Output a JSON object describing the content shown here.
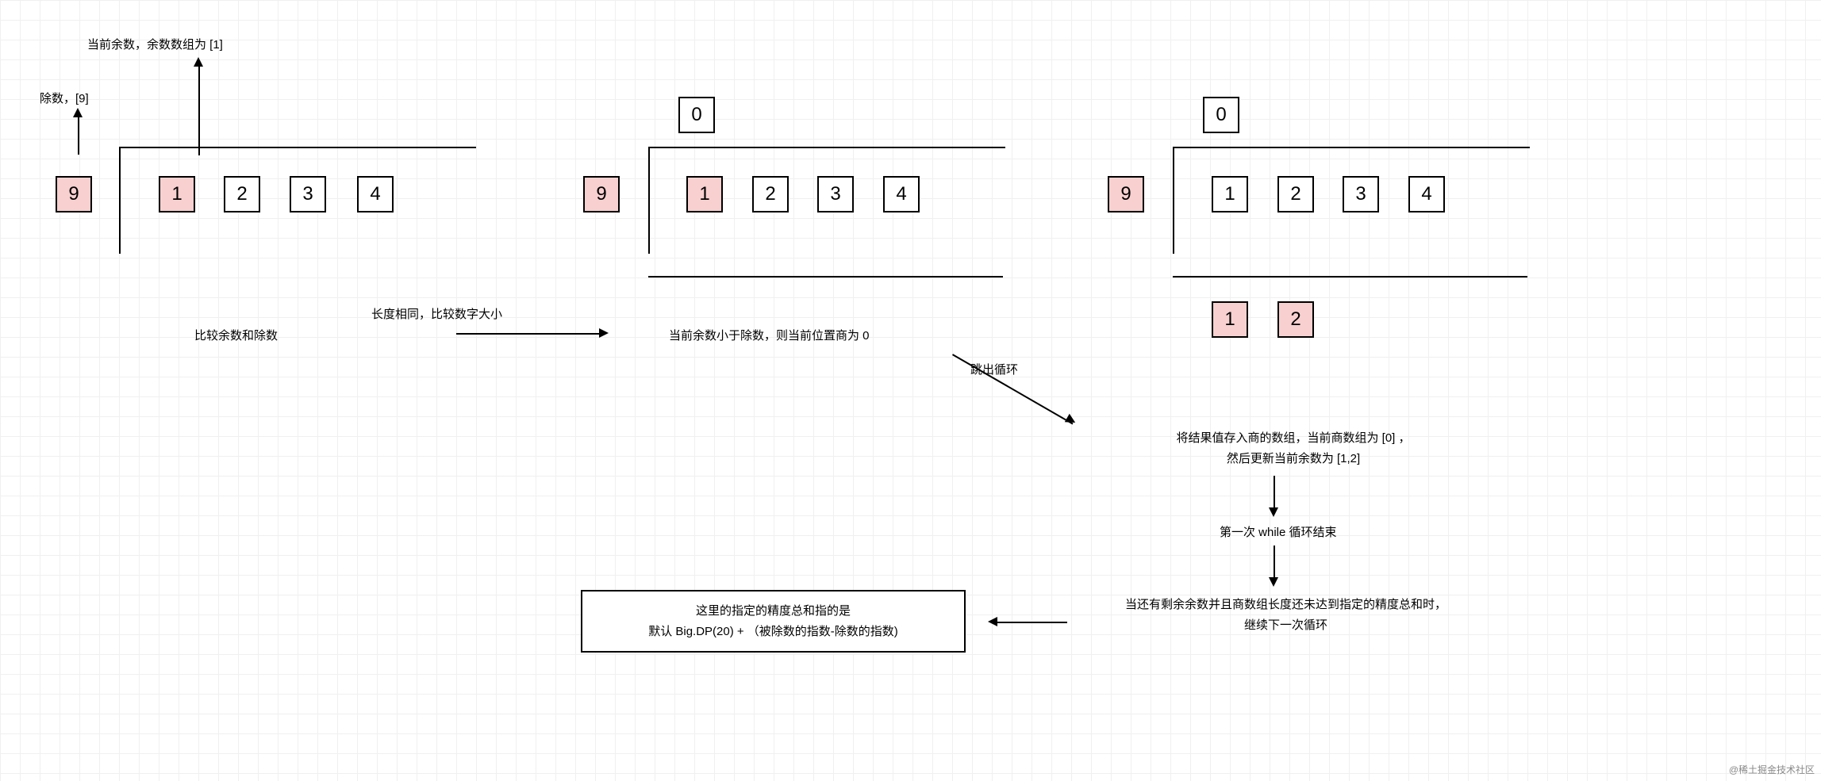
{
  "labels": {
    "divisor_label": "除数，[9]",
    "remainder_label": "当前余数，余数数组为 [1]",
    "step1_compare": "比较余数和除数",
    "step1_arrow_text": "长度相同，比较数字大小",
    "step2_text": "当前余数小于除数，则当前位置商为 0",
    "step3_break": "跳出循环",
    "step3_result_l1": "将结果值存入商的数组，当前商数组为 [0] ，",
    "step3_result_l2": "然后更新当前余数为 [1,2]",
    "step3_while_end": "第一次 while 循环结束",
    "step3_precision_l1": "当还有剩余余数并且商数组长度还未达到指定的精度总和时，",
    "step3_precision_l2": "继续下一次循环",
    "box_precision_l1": "这里的指定的精度总和指的是",
    "box_precision_l2": "默认 Big.DP(20) + （被除数的指数-除数的指数)"
  },
  "cells": {
    "group1": {
      "divisor": "9",
      "d1": "1",
      "d2": "2",
      "d3": "3",
      "d4": "4"
    },
    "group2": {
      "quotient": "0",
      "divisor": "9",
      "d1": "1",
      "d2": "2",
      "d3": "3",
      "d4": "4"
    },
    "group3": {
      "quotient": "0",
      "divisor": "9",
      "d1": "1",
      "d2": "2",
      "d3": "3",
      "d4": "4",
      "r1": "1",
      "r2": "2"
    }
  },
  "watermark": "@稀土掘金技术社区"
}
